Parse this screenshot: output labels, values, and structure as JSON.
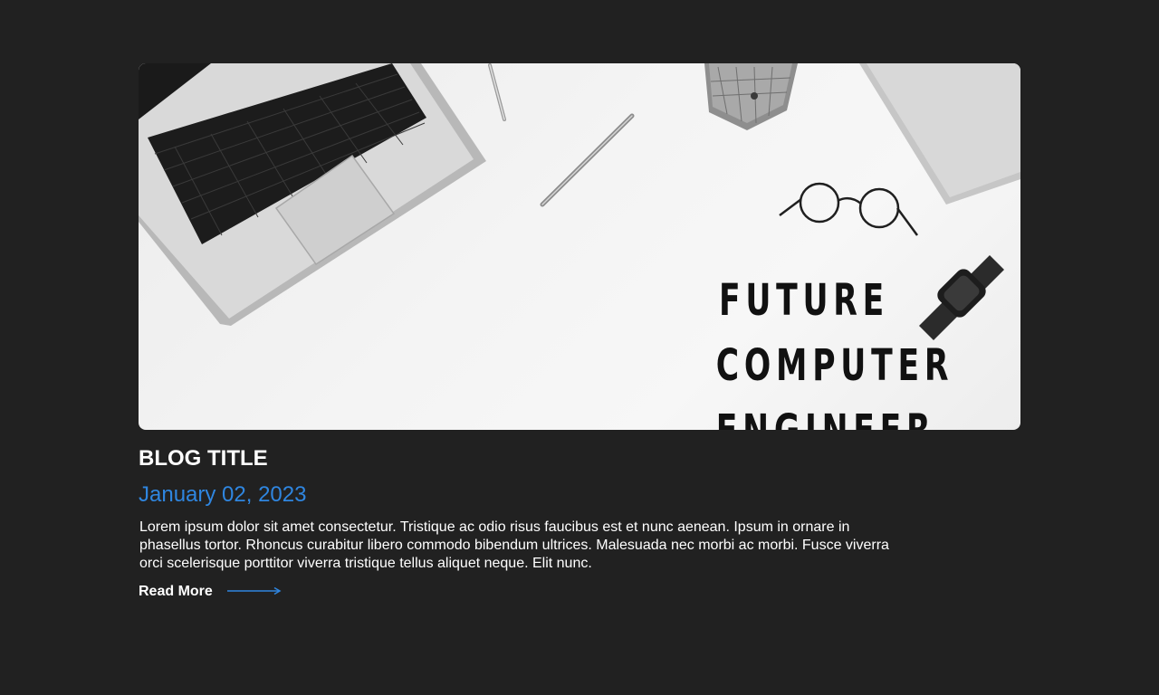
{
  "post": {
    "hero_text_lines": [
      "FUTURE",
      "COMPUTER",
      "ENGINEER"
    ],
    "title": "BLOG TITLE",
    "date": "January 02, 2023",
    "excerpt": "Lorem ipsum dolor sit amet consectetur. Tristique ac odio risus faucibus est et nunc aenean. Ipsum in ornare in phasellus tortor. Rhoncus curabitur libero commodo bibendum ultrices. Malesuada nec morbi ac morbi. Fusce viverra orci scelerisque porttitor viverra tristique tellus aliquet neque. Elit nunc.",
    "read_more_label": "Read More"
  },
  "colors": {
    "background": "#212121",
    "accent": "#2f86e0",
    "text": "#ffffff"
  },
  "icons": {
    "read_more_arrow": "arrow-right-icon"
  }
}
